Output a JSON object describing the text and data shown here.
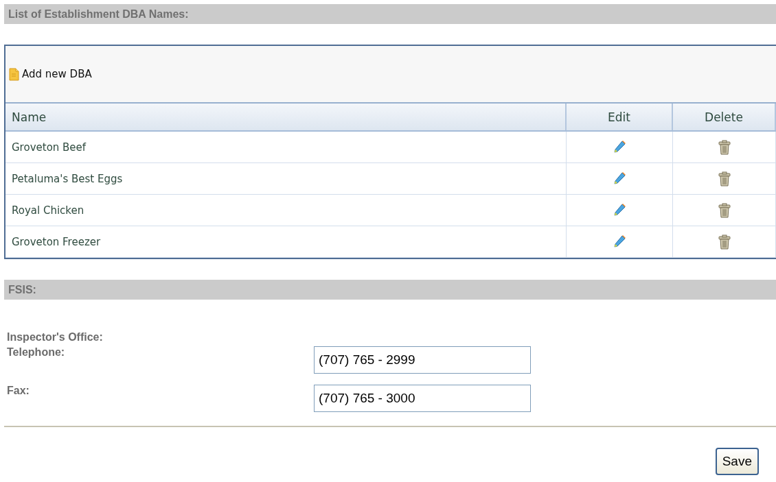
{
  "dba_section": {
    "title": "List of Establishment DBA Names:"
  },
  "dba_table": {
    "add_link": "Add new DBA",
    "columns": [
      "Name",
      "Edit",
      "Delete"
    ],
    "rows": [
      {
        "name": "Groveton Beef"
      },
      {
        "name": "Petaluma's Best Eggs"
      },
      {
        "name": "Royal Chicken"
      },
      {
        "name": "Groveton Freezer"
      }
    ]
  },
  "fsis_section": {
    "title": "FSIS:"
  },
  "form": {
    "office_label": "Inspector's Office:",
    "fields": [
      {
        "label": "Telephone:",
        "value": "(707) 765 - 2999"
      },
      {
        "label": "Fax:",
        "value": "(707) 765 - 3000"
      }
    ]
  },
  "save_button": "Save"
}
